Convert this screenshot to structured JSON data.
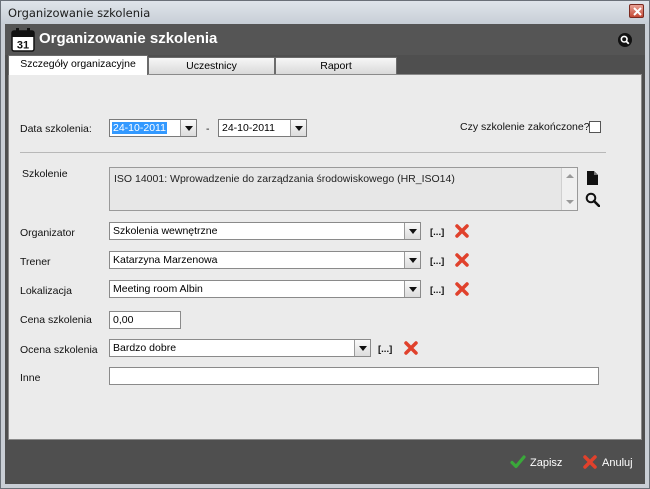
{
  "window": {
    "title": "Organizowanie szkolenia"
  },
  "header": {
    "title": "Organizowanie szkolenia",
    "calendar_day": "31"
  },
  "tabs": [
    {
      "label": "Szczegóły organizacyjne",
      "active": true
    },
    {
      "label": "Uczestnicy",
      "active": false
    },
    {
      "label": "Raport",
      "active": false
    }
  ],
  "form": {
    "date_label": "Data szkolenia:",
    "date_from": "24-10-2011",
    "date_sep": "-",
    "date_to": "24-10-2011",
    "finished_label": "Czy szkolenie zakończone?",
    "finished_checked": false,
    "training_label": "Szkolenie",
    "training_value": "ISO 14001: Wprowadzenie do zarządzania środowiskowego (HR_ISO14)",
    "organizer_label": "Organizator",
    "organizer_value": "Szkolenia wewnętrzne",
    "trainer_label": "Trener",
    "trainer_value": "Katarzyna Marzenowa",
    "location_label": "Lokalizacja",
    "location_value": "Meeting room Albin",
    "price_label": "Cena szkolenia",
    "price_value": "0,00",
    "rating_label": "Ocena szkolenia",
    "rating_value": "Bardzo dobre",
    "other_label": "Inne",
    "other_value": "",
    "browse_label": "[...]"
  },
  "footer": {
    "save_label": "Zapisz",
    "cancel_label": "Anuluj"
  },
  "colors": {
    "header_bg": "#555555",
    "panel_bg": "#ebebeb",
    "save_green": "#3aa83a",
    "cancel_red": "#e0412c",
    "selection_blue": "#3399ff"
  }
}
